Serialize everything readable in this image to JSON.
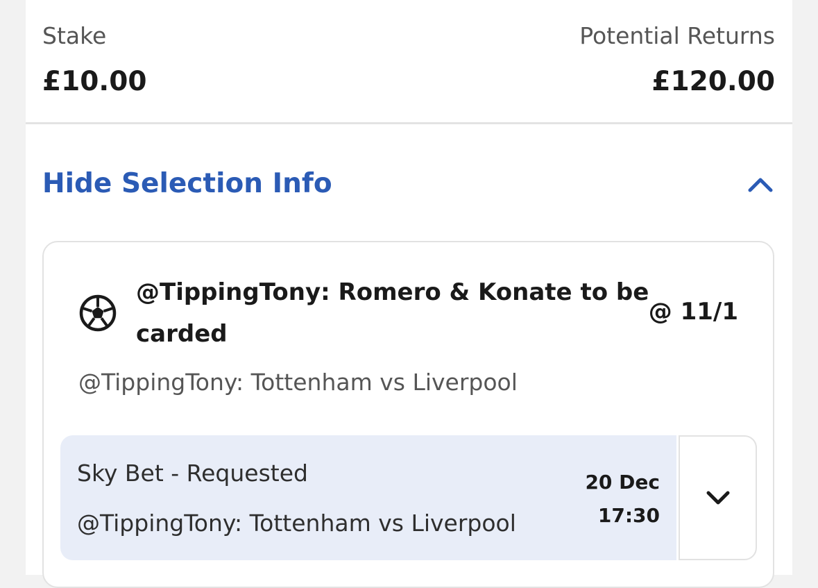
{
  "bet": {
    "stake_label": "Stake",
    "stake_value": "£10.00",
    "returns_label": "Potential Returns",
    "returns_value": "£120.00"
  },
  "selection_toggle": {
    "label": "Hide Selection Info",
    "icon": "chevron-up-icon"
  },
  "selection": {
    "icon": "football-icon",
    "title": "@TippingTony: Romero & Konate to be carded",
    "odds": "@ 11/1",
    "event": "@TippingTony: Tottenham vs Liverpool"
  },
  "sub_selection": {
    "line1": "Sky Bet - Requested",
    "line2": "@TippingTony: Tottenham vs Liverpool",
    "date": "20 Dec",
    "time": "17:30",
    "expand_icon": "chevron-down-icon"
  },
  "colors": {
    "accent": "#2b5bb5",
    "info_background": "#e8edf8",
    "page_background": "#f2f2f2",
    "card_border": "#e2e2e2"
  }
}
